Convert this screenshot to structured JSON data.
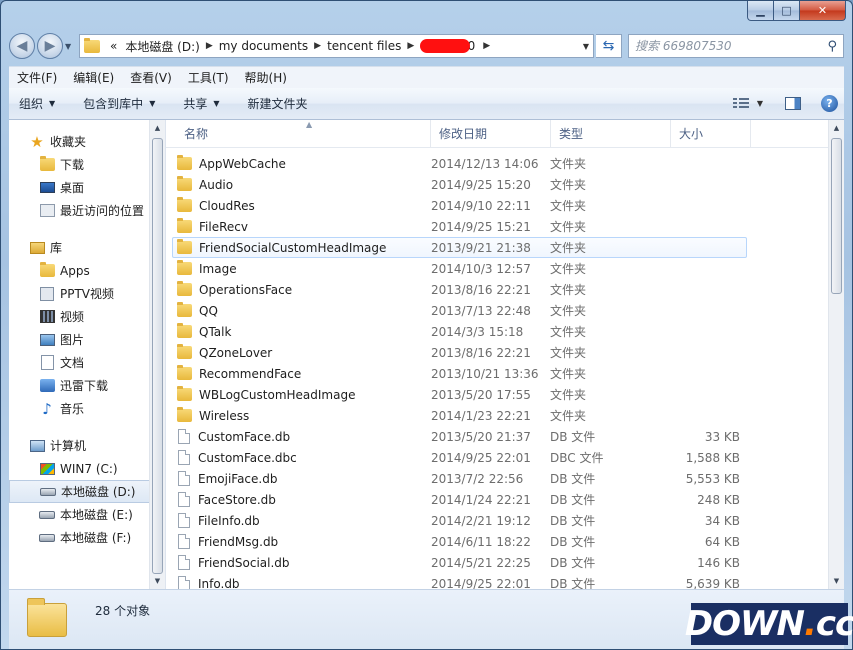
{
  "address": {
    "overflow": "«",
    "crumbs": [
      "本地磁盘 (D:)",
      "my documents",
      "tencent files"
    ],
    "redacted_tail": "530"
  },
  "search": {
    "placeholder": "搜索 669807530"
  },
  "menu": [
    "文件(F)",
    "编辑(E)",
    "查看(V)",
    "工具(T)",
    "帮助(H)"
  ],
  "commands": {
    "organize": "组织",
    "include_library": "包含到库中",
    "share": "共享",
    "new_folder": "新建文件夹"
  },
  "nav": {
    "favorites": "收藏夹",
    "downloads": "下载",
    "desktop": "桌面",
    "recent": "最近访问的位置",
    "libraries": "库",
    "apps": "Apps",
    "pptv": "PPTV视频",
    "videos": "视频",
    "pictures": "图片",
    "documents": "文档",
    "xunlei": "迅雷下载",
    "music": "音乐",
    "computer": "计算机",
    "drive_c": "WIN7 (C:)",
    "drive_d": "本地磁盘 (D:)",
    "drive_e": "本地磁盘 (E:)",
    "drive_f": "本地磁盘 (F:)"
  },
  "columns": {
    "name": "名称",
    "date": "修改日期",
    "type": "类型",
    "size": "大小"
  },
  "files": [
    {
      "name": "AppWebCache",
      "date": "2014/12/13 14:06",
      "type": "文件夹",
      "size": "",
      "kind": "folder"
    },
    {
      "name": "Audio",
      "date": "2014/9/25 15:20",
      "type": "文件夹",
      "size": "",
      "kind": "folder"
    },
    {
      "name": "CloudRes",
      "date": "2014/9/10 22:11",
      "type": "文件夹",
      "size": "",
      "kind": "folder"
    },
    {
      "name": "FileRecv",
      "date": "2014/9/25 15:21",
      "type": "文件夹",
      "size": "",
      "kind": "folder"
    },
    {
      "name": "FriendSocialCustomHeadImage",
      "date": "2013/9/21 21:38",
      "type": "文件夹",
      "size": "",
      "kind": "folder"
    },
    {
      "name": "Image",
      "date": "2014/10/3 12:57",
      "type": "文件夹",
      "size": "",
      "kind": "folder"
    },
    {
      "name": "OperationsFace",
      "date": "2013/8/16 22:21",
      "type": "文件夹",
      "size": "",
      "kind": "folder"
    },
    {
      "name": "QQ",
      "date": "2013/7/13 22:48",
      "type": "文件夹",
      "size": "",
      "kind": "folder"
    },
    {
      "name": "QTalk",
      "date": "2014/3/3 15:18",
      "type": "文件夹",
      "size": "",
      "kind": "folder"
    },
    {
      "name": "QZoneLover",
      "date": "2013/8/16 22:21",
      "type": "文件夹",
      "size": "",
      "kind": "folder"
    },
    {
      "name": "RecommendFace",
      "date": "2013/10/21 13:36",
      "type": "文件夹",
      "size": "",
      "kind": "folder"
    },
    {
      "name": "WBLogCustomHeadImage",
      "date": "2013/5/20 17:55",
      "type": "文件夹",
      "size": "",
      "kind": "folder"
    },
    {
      "name": "Wireless",
      "date": "2014/1/23 22:21",
      "type": "文件夹",
      "size": "",
      "kind": "folder"
    },
    {
      "name": "CustomFace.db",
      "date": "2013/5/20 21:37",
      "type": "DB 文件",
      "size": "33 KB",
      "kind": "file"
    },
    {
      "name": "CustomFace.dbc",
      "date": "2014/9/25 22:01",
      "type": "DBC 文件",
      "size": "1,588 KB",
      "kind": "file"
    },
    {
      "name": "EmojiFace.db",
      "date": "2013/7/2 22:56",
      "type": "DB 文件",
      "size": "5,553 KB",
      "kind": "file"
    },
    {
      "name": "FaceStore.db",
      "date": "2014/1/24 22:21",
      "type": "DB 文件",
      "size": "248 KB",
      "kind": "file"
    },
    {
      "name": "FileInfo.db",
      "date": "2014/2/21 19:12",
      "type": "DB 文件",
      "size": "34 KB",
      "kind": "file"
    },
    {
      "name": "FriendMsg.db",
      "date": "2014/6/11 18:22",
      "type": "DB 文件",
      "size": "64 KB",
      "kind": "file"
    },
    {
      "name": "FriendSocial.db",
      "date": "2014/5/21 22:25",
      "type": "DB 文件",
      "size": "146 KB",
      "kind": "file"
    },
    {
      "name": "Info.db",
      "date": "2014/9/25 22:01",
      "type": "DB 文件",
      "size": "5,639 KB",
      "kind": "file"
    }
  ],
  "hover_row": 4,
  "status": {
    "count": "28 个对象"
  },
  "watermark": {
    "main": "DOWN",
    "dot": ".",
    "tld": "cc"
  }
}
